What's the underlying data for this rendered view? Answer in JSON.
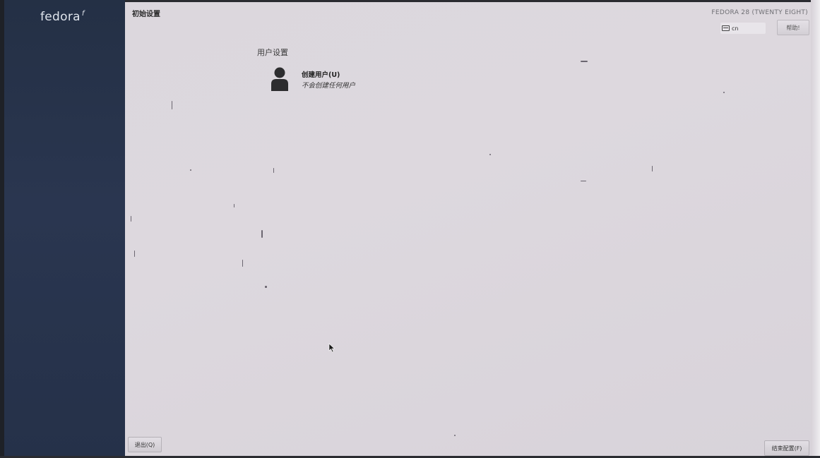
{
  "sidebar": {
    "logo_text": "fedora",
    "logo_mark": "f"
  },
  "header": {
    "title": "初始设置",
    "product_name": "FEDORA 28 (TWENTY EIGHT)",
    "keyboard_layout": "cn",
    "help_label": "帮助!"
  },
  "hub": {
    "section_title": "用户设置",
    "spokes": [
      {
        "icon": "user-icon",
        "title": "创建用户(U)",
        "status": "不会创建任何用户"
      }
    ]
  },
  "footer": {
    "quit_label": "退出(Q)",
    "finish_label": "结束配置(F)"
  },
  "colors": {
    "sidebar": "#253149",
    "background": "#dcd7dd",
    "text": "#222222"
  }
}
